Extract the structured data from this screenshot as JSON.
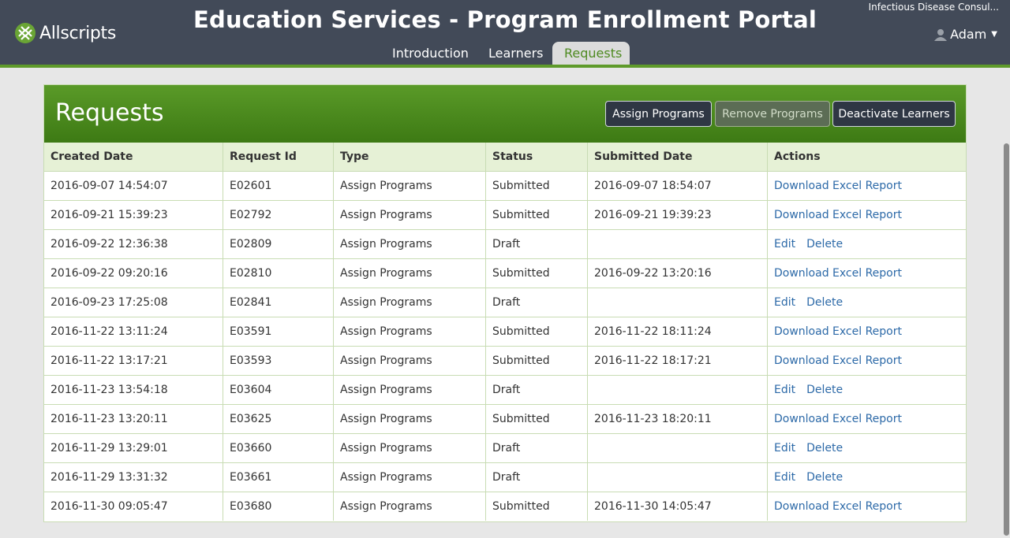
{
  "app": {
    "logo_text": "Allscripts",
    "title": "Education Services - Program Enrollment Portal",
    "org": "Infectious Disease Consul...",
    "user": "Adam"
  },
  "tabs": [
    {
      "label": "Introduction",
      "active": false
    },
    {
      "label": "Learners",
      "active": false
    },
    {
      "label": "Requests",
      "active": true
    }
  ],
  "panel": {
    "title": "Requests",
    "buttons": {
      "assign": "Assign Programs",
      "remove": "Remove Programs",
      "deactivate": "Deactivate Learners"
    }
  },
  "table": {
    "columns": [
      "Created Date",
      "Request Id",
      "Type",
      "Status",
      "Submitted Date",
      "Actions"
    ],
    "rows": [
      {
        "created": "2016-09-07 14:54:07",
        "id": "E02601",
        "type": "Assign Programs",
        "status": "Submitted",
        "submitted": "2016-09-07 18:54:07",
        "actions": [
          "Download Excel Report"
        ]
      },
      {
        "created": "2016-09-21 15:39:23",
        "id": "E02792",
        "type": "Assign Programs",
        "status": "Submitted",
        "submitted": "2016-09-21 19:39:23",
        "actions": [
          "Download Excel Report"
        ]
      },
      {
        "created": "2016-09-22 12:36:38",
        "id": "E02809",
        "type": "Assign Programs",
        "status": "Draft",
        "submitted": "",
        "actions": [
          "Edit",
          "Delete"
        ]
      },
      {
        "created": "2016-09-22 09:20:16",
        "id": "E02810",
        "type": "Assign Programs",
        "status": "Submitted",
        "submitted": "2016-09-22 13:20:16",
        "actions": [
          "Download Excel Report"
        ]
      },
      {
        "created": "2016-09-23 17:25:08",
        "id": "E02841",
        "type": "Assign Programs",
        "status": "Draft",
        "submitted": "",
        "actions": [
          "Edit",
          "Delete"
        ]
      },
      {
        "created": "2016-11-22 13:11:24",
        "id": "E03591",
        "type": "Assign Programs",
        "status": "Submitted",
        "submitted": "2016-11-22 18:11:24",
        "actions": [
          "Download Excel Report"
        ]
      },
      {
        "created": "2016-11-22 13:17:21",
        "id": "E03593",
        "type": "Assign Programs",
        "status": "Submitted",
        "submitted": "2016-11-22 18:17:21",
        "actions": [
          "Download Excel Report"
        ]
      },
      {
        "created": "2016-11-23 13:54:18",
        "id": "E03604",
        "type": "Assign Programs",
        "status": "Draft",
        "submitted": "",
        "actions": [
          "Edit",
          "Delete"
        ]
      },
      {
        "created": "2016-11-23 13:20:11",
        "id": "E03625",
        "type": "Assign Programs",
        "status": "Submitted",
        "submitted": "2016-11-23 18:20:11",
        "actions": [
          "Download Excel Report"
        ]
      },
      {
        "created": "2016-11-29 13:29:01",
        "id": "E03660",
        "type": "Assign Programs",
        "status": "Draft",
        "submitted": "",
        "actions": [
          "Edit",
          "Delete"
        ]
      },
      {
        "created": "2016-11-29 13:31:32",
        "id": "E03661",
        "type": "Assign Programs",
        "status": "Draft",
        "submitted": "",
        "actions": [
          "Edit",
          "Delete"
        ]
      },
      {
        "created": "2016-11-30 09:05:47",
        "id": "E03680",
        "type": "Assign Programs",
        "status": "Submitted",
        "submitted": "2016-11-30 14:05:47",
        "actions": [
          "Download Excel Report"
        ]
      }
    ]
  },
  "icons": {
    "logo": "allscripts-logo-icon",
    "user": "user-icon",
    "caret": "caret-down-icon"
  },
  "colors": {
    "header": "#424a58",
    "accent": "#5e9a2a",
    "link": "#2d6aa8",
    "panel_head": "#4a8a1e"
  }
}
